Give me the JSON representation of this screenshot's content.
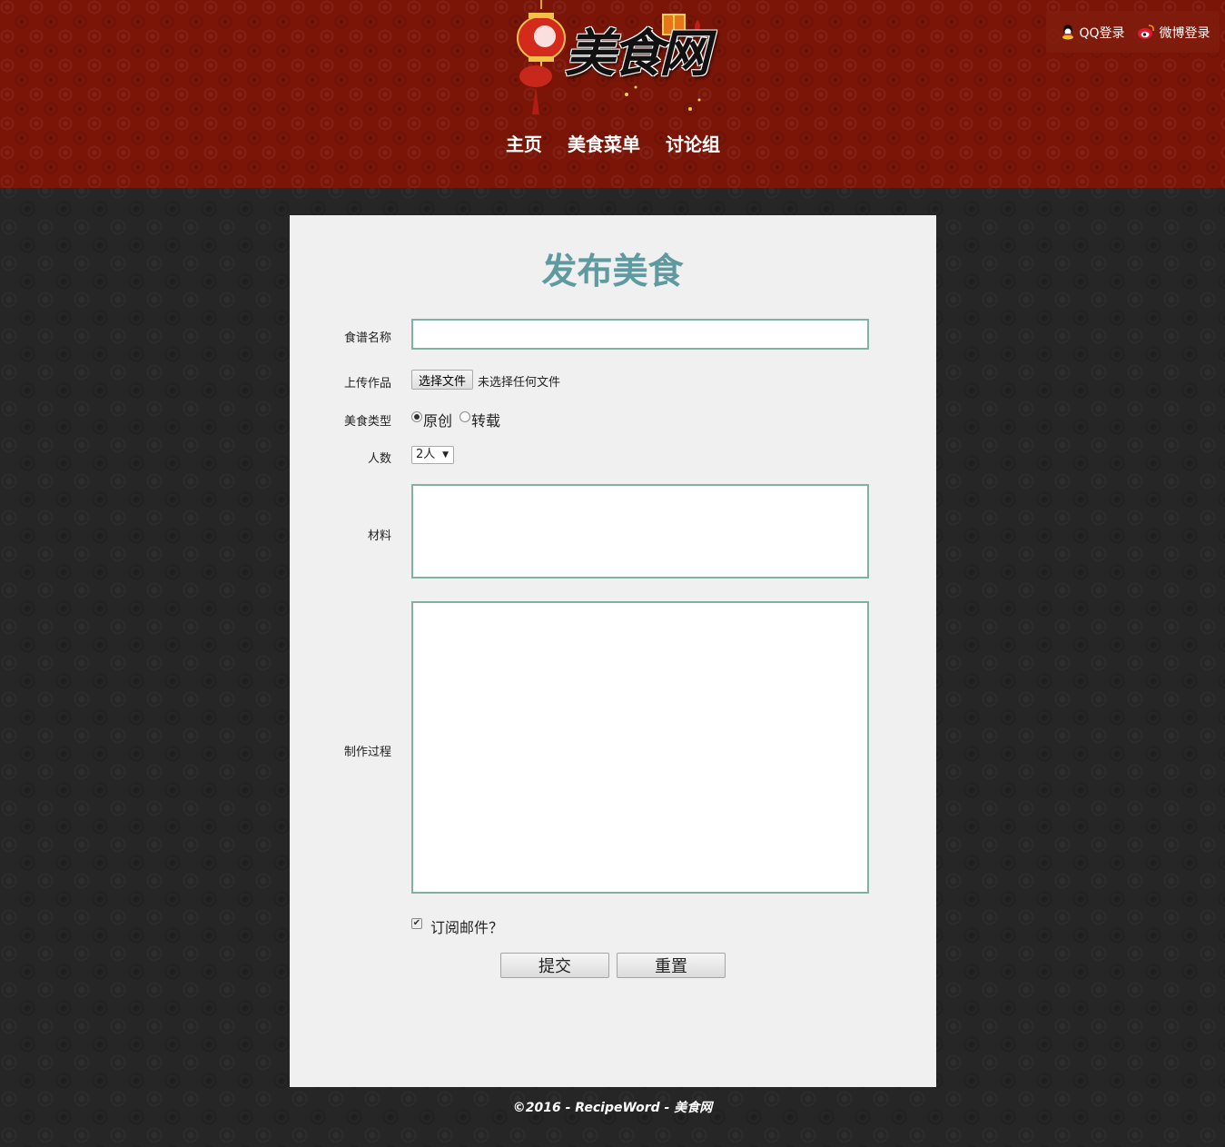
{
  "header": {
    "logo_text": "美食网",
    "login": {
      "qq": "QQ登录",
      "weibo": "微博登录"
    },
    "nav": [
      "主页",
      "美食菜单",
      "讨论组"
    ]
  },
  "form": {
    "title": "发布美食",
    "recipe_name_label": "食谱名称",
    "recipe_name_value": "",
    "upload_label": "上传作品",
    "upload_button": "选择文件",
    "upload_status": "未选择任何文件",
    "type_label": "美食类型",
    "type_options": [
      "原创",
      "转载"
    ],
    "type_selected": "原创",
    "servings_label": "人数",
    "servings_value": "2人",
    "ingredients_label": "材料",
    "ingredients_value": "",
    "process_label": "制作过程",
    "process_value": "",
    "subscribe_label": "订阅邮件？",
    "subscribe_checked": true,
    "submit_label": "提交",
    "reset_label": "重置"
  },
  "footer": {
    "text": "©2016 - RecipeWord - 美食网"
  },
  "colors": {
    "header_bg": "#7a1508",
    "page_bg": "#262626",
    "panel_bg": "#f0f0f0",
    "title": "#5e9aa0",
    "field_border": "#7fb2a0"
  }
}
